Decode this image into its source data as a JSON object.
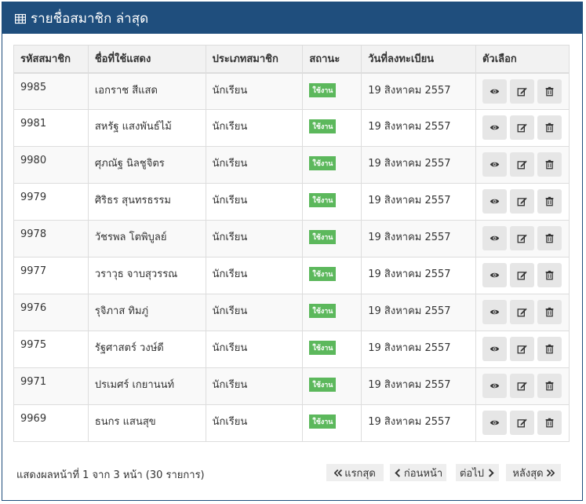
{
  "panel": {
    "title": "รายชื่อสมาชิก ล่าสุด",
    "icon": "table-icon"
  },
  "table": {
    "headers": [
      "รหัสสมาชิก",
      "ชื่อที่ใช้แสดง",
      "ประเภทสมาชิก",
      "สถานะ",
      "วันที่ลงทะเบียน",
      "ตัวเลือก"
    ],
    "rows": [
      {
        "id": "9985",
        "name": "เอกราช สีแสด",
        "type": "นักเรียน",
        "status": "ใช้งาน",
        "date": "19 สิงหาคม 2557"
      },
      {
        "id": "9981",
        "name": "สหรัฐ แสงพันธ์ไม้",
        "type": "นักเรียน",
        "status": "ใช้งาน",
        "date": "19 สิงหาคม 2557"
      },
      {
        "id": "9980",
        "name": "ศุภณัฐ นิลชูจิตร",
        "type": "นักเรียน",
        "status": "ใช้งาน",
        "date": "19 สิงหาคม 2557"
      },
      {
        "id": "9979",
        "name": "ศิริธร สุนทรธรรม",
        "type": "นักเรียน",
        "status": "ใช้งาน",
        "date": "19 สิงหาคม 2557"
      },
      {
        "id": "9978",
        "name": "วัชรพล โตพิบูลย์",
        "type": "นักเรียน",
        "status": "ใช้งาน",
        "date": "19 สิงหาคม 2557"
      },
      {
        "id": "9977",
        "name": "วราวุธ จาบสุวรรณ",
        "type": "นักเรียน",
        "status": "ใช้งาน",
        "date": "19 สิงหาคม 2557"
      },
      {
        "id": "9976",
        "name": "รุจิภาส ทิมภู่",
        "type": "นักเรียน",
        "status": "ใช้งาน",
        "date": "19 สิงหาคม 2557"
      },
      {
        "id": "9975",
        "name": "รัฐศาสตร์ วงษ์ดี",
        "type": "นักเรียน",
        "status": "ใช้งาน",
        "date": "19 สิงหาคม 2557"
      },
      {
        "id": "9971",
        "name": "ปรเมศร์ เกยานนท์",
        "type": "นักเรียน",
        "status": "ใช้งาน",
        "date": "19 สิงหาคม 2557"
      },
      {
        "id": "9969",
        "name": "ธนกร แสนสุข",
        "type": "นักเรียน",
        "status": "ใช้งาน",
        "date": "19 สิงหาคม 2557"
      }
    ],
    "action_icons": [
      "eye-icon",
      "edit-icon",
      "trash-icon"
    ]
  },
  "footer": {
    "info": "แสดงผลหน้าที่ 1 จาก 3 หน้า (30 รายการ)"
  },
  "pager": {
    "first": "แรกสุด",
    "prev": "ก่อนหน้า",
    "next": "ต่อไป",
    "last": "หลังสุด"
  },
  "colors": {
    "header": "#1f4e7d",
    "badge": "#5cb85c"
  }
}
